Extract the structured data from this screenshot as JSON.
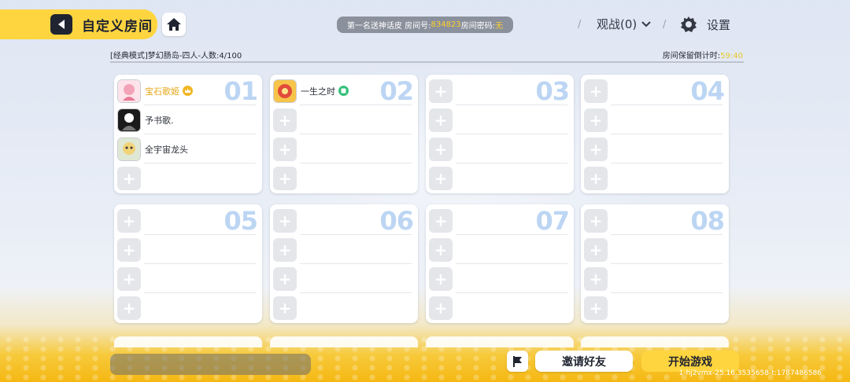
{
  "header": {
    "title": "自定义房间",
    "room_info": {
      "prefix": "第一名送神话皮 房间号:",
      "room_number": "834823",
      "password_label": " 房间密码:",
      "password_value": "无"
    },
    "spectate_label": "观战(0)",
    "settings_label": "设置"
  },
  "mode_line": "[经典模式]梦幻肠岛-四人-人数:4/100",
  "timer": {
    "label": "房间保留倒计时:",
    "value": "59:40"
  },
  "teams": [
    {
      "number": "01",
      "slots": [
        {
          "name": "宝石歌姬",
          "occupied": true,
          "highlight": true,
          "badge": "crown-badge"
        },
        {
          "name": "予书歌.",
          "occupied": true
        },
        {
          "name": "全宇宙龙头",
          "occupied": true
        },
        {
          "occupied": false
        }
      ]
    },
    {
      "number": "02",
      "slots": [
        {
          "name": "一生之时",
          "occupied": true,
          "badge": "green-badge"
        },
        {
          "occupied": false
        },
        {
          "occupied": false
        },
        {
          "occupied": false
        }
      ]
    },
    {
      "number": "03",
      "slots": [
        {
          "occupied": false
        },
        {
          "occupied": false
        },
        {
          "occupied": false
        },
        {
          "occupied": false
        }
      ]
    },
    {
      "number": "04",
      "slots": [
        {
          "occupied": false
        },
        {
          "occupied": false
        },
        {
          "occupied": false
        },
        {
          "occupied": false
        }
      ]
    },
    {
      "number": "05",
      "slots": [
        {
          "occupied": false
        },
        {
          "occupied": false
        },
        {
          "occupied": false
        },
        {
          "occupied": false
        }
      ]
    },
    {
      "number": "06",
      "slots": [
        {
          "occupied": false
        },
        {
          "occupied": false
        },
        {
          "occupied": false
        },
        {
          "occupied": false
        }
      ]
    },
    {
      "number": "07",
      "slots": [
        {
          "occupied": false
        },
        {
          "occupied": false
        },
        {
          "occupied": false
        },
        {
          "occupied": false
        }
      ]
    },
    {
      "number": "08",
      "slots": [
        {
          "occupied": false
        },
        {
          "occupied": false
        },
        {
          "occupied": false
        },
        {
          "occupied": false
        }
      ]
    }
  ],
  "bottom": {
    "invite_label": "邀请好友",
    "start_label": "开始游戏",
    "version": "1-hj2vmx-25.16.3535658-t:1787486586"
  },
  "colors": {
    "accent": "#ffd53f",
    "team_number": "#bcd5f3",
    "highlight_name": "#e6a81a"
  }
}
